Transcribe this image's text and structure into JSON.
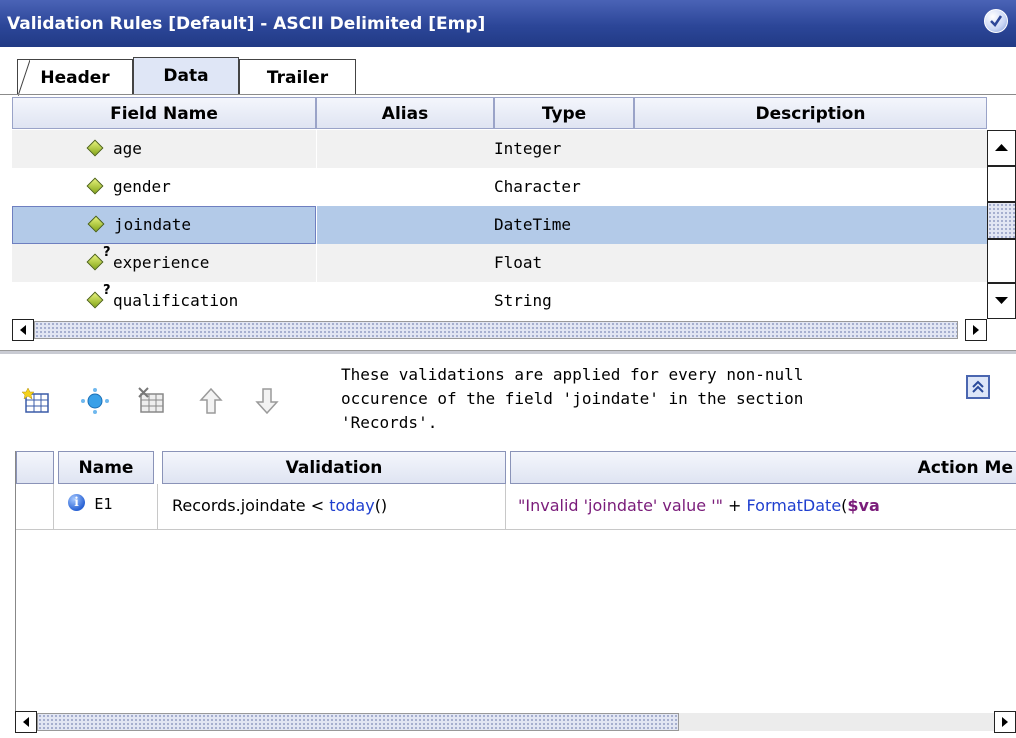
{
  "window": {
    "title": "Validation Rules [Default] - ASCII Delimited [Emp]"
  },
  "tabs": [
    {
      "label": "Header",
      "active": false
    },
    {
      "label": "Data",
      "active": true
    },
    {
      "label": "Trailer",
      "active": false
    }
  ],
  "fields_grid": {
    "columns": [
      "Field Name",
      "Alias",
      "Type",
      "Description"
    ],
    "rows": [
      {
        "name": "age",
        "alias": "",
        "type": "Integer",
        "description": "",
        "optional": false
      },
      {
        "name": "gender",
        "alias": "",
        "type": "Character",
        "description": "",
        "optional": false
      },
      {
        "name": "joindate",
        "alias": "",
        "type": "DateTime",
        "description": "",
        "optional": false,
        "selected": true
      },
      {
        "name": "experience",
        "alias": "",
        "type": "Float",
        "description": "",
        "optional": true
      },
      {
        "name": "qualification",
        "alias": "",
        "type": "String",
        "description": "",
        "optional": true
      }
    ],
    "optional_mark": "?"
  },
  "toolbar": {
    "icons": [
      "new-validation-icon",
      "add-rule-icon",
      "delete-validation-icon",
      "move-up-icon",
      "move-down-icon"
    ],
    "message_lines": [
      "These validations are applied for every non-null",
      "occurence of the field 'joindate' in the section",
      "'Records'."
    ]
  },
  "validations_grid": {
    "columns": [
      "",
      "Name",
      "Validation",
      "Action Me"
    ],
    "rows": [
      {
        "icon": "info-icon",
        "name": "E1",
        "validation_expr": "Records.joindate",
        "validation_op": " < ",
        "validation_func": "today",
        "validation_paren": "()",
        "action_str": "\"Invalid 'joindate' value '\"",
        "action_plus": " + ",
        "action_func": "FormatDate",
        "action_open": "(",
        "action_var": "$va"
      }
    ]
  },
  "colors": {
    "title_bar": "#2c4698",
    "selected_row": "#b3cae8",
    "keyword": "#1f3fcf",
    "string": "#7a1c7a"
  }
}
